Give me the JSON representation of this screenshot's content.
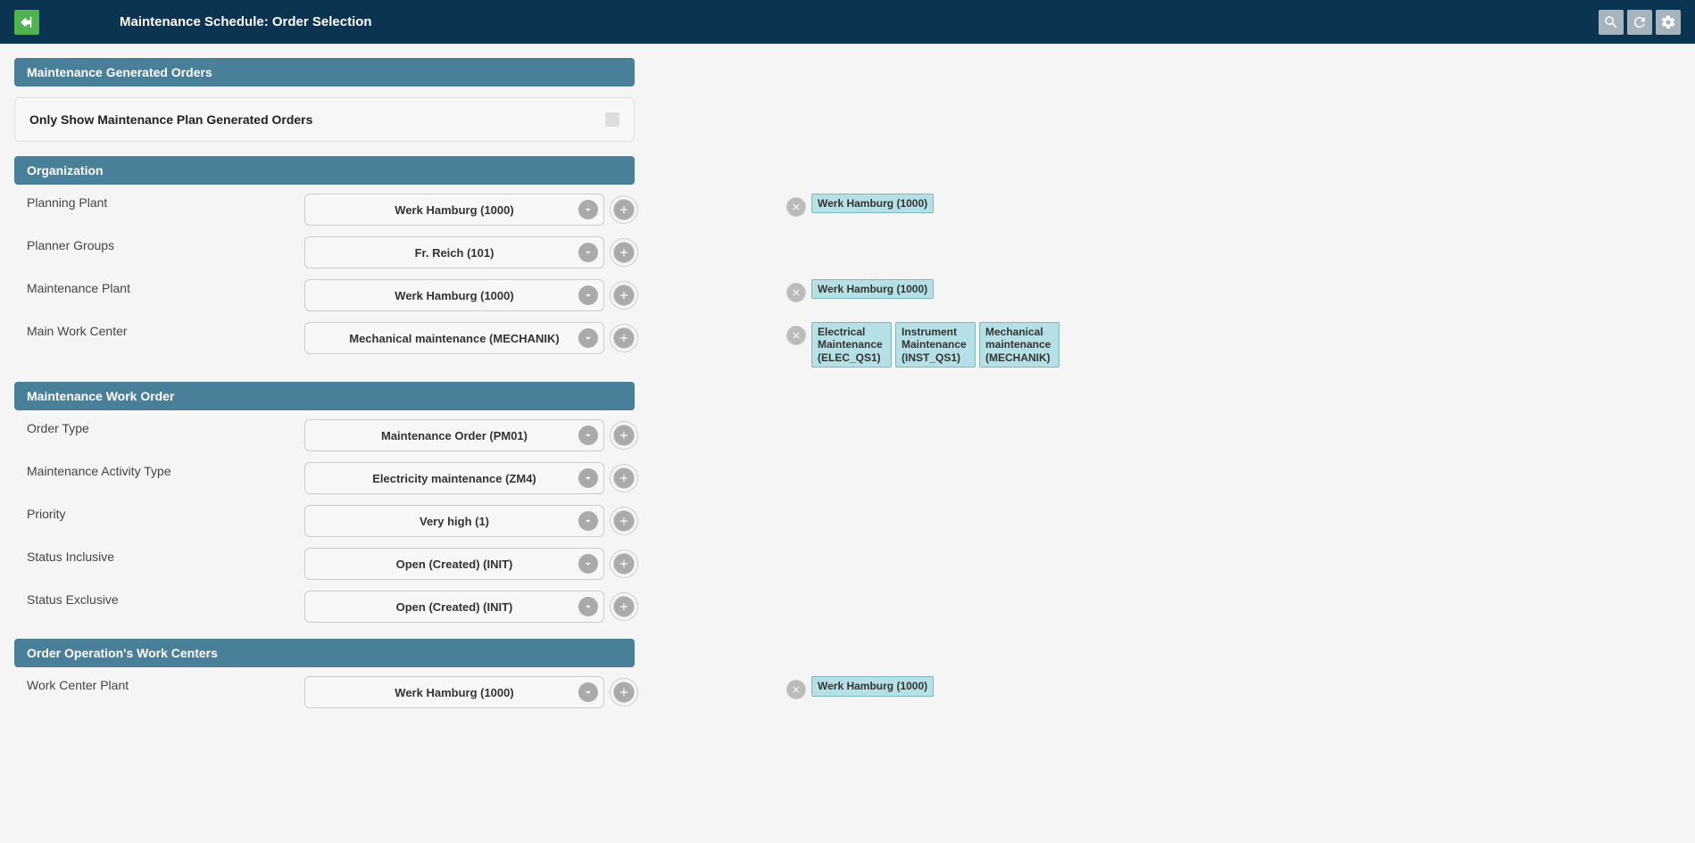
{
  "header": {
    "title": "Maintenance Schedule: Order Selection"
  },
  "sections": {
    "generated": {
      "title": "Maintenance Generated Orders",
      "checkbox_label": "Only Show Maintenance Plan Generated Orders"
    },
    "organization": {
      "title": "Organization",
      "fields": {
        "planning_plant": {
          "label": "Planning Plant",
          "value": "Werk Hamburg (1000)",
          "tags": [
            "Werk Hamburg (1000)"
          ]
        },
        "planner_groups": {
          "label": "Planner Groups",
          "value": "Fr. Reich (101)",
          "tags": []
        },
        "maintenance_plant": {
          "label": "Maintenance Plant",
          "value": "Werk Hamburg (1000)",
          "tags": [
            "Werk Hamburg (1000)"
          ]
        },
        "main_work_center": {
          "label": "Main Work Center",
          "value": "Mechanical maintenance (MECHANIK)",
          "tags": [
            "Electrical Maintenance (ELEC_QS1)",
            "Instrument Maintenance (INST_QS1)",
            "Mechanical maintenance (MECHANIK)"
          ]
        }
      }
    },
    "work_order": {
      "title": "Maintenance Work Order",
      "fields": {
        "order_type": {
          "label": "Order Type",
          "value": "Maintenance Order (PM01)"
        },
        "activity_type": {
          "label": "Maintenance Activity Type",
          "value": "Electricity maintenance (ZM4)"
        },
        "priority": {
          "label": "Priority",
          "value": "Very high (1)"
        },
        "status_inclusive": {
          "label": "Status Inclusive",
          "value": "Open (Created) (INIT)"
        },
        "status_exclusive": {
          "label": "Status Exclusive",
          "value": "Open (Created) (INIT)"
        }
      }
    },
    "operation_centers": {
      "title": "Order Operation's Work Centers",
      "fields": {
        "work_center_plant": {
          "label": "Work Center Plant",
          "value": "Werk Hamburg (1000)",
          "tags": [
            "Werk Hamburg (1000)"
          ]
        }
      }
    }
  }
}
